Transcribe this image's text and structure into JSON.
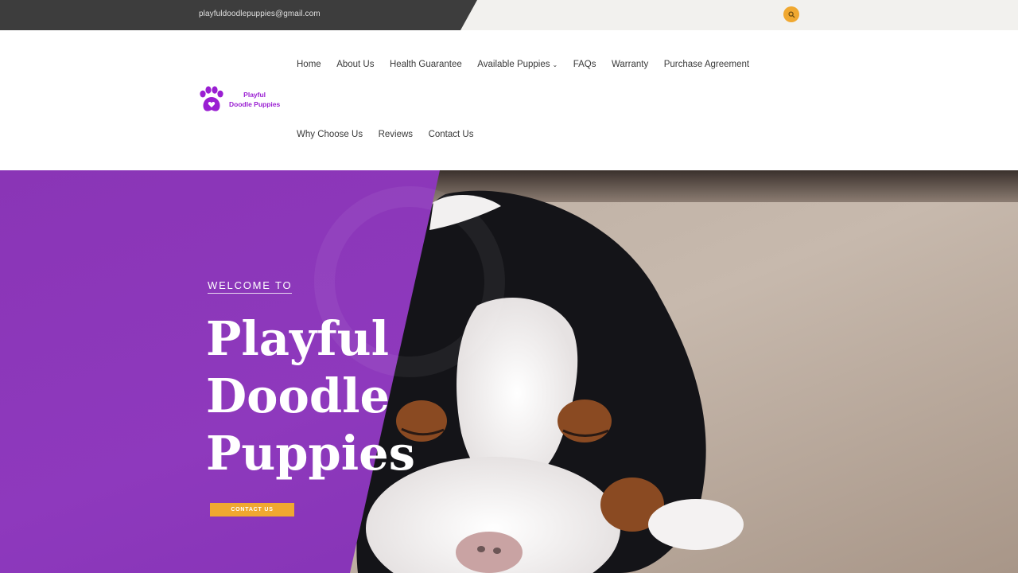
{
  "topbar": {
    "email": "playfuldoodlepuppies@gmail.com",
    "search_icon": "search-icon",
    "accent": "#f0a830"
  },
  "logo": {
    "line1": "Playful",
    "line2": "Doodle Puppies",
    "icon": "paw-heart-icon",
    "color": "#9a1ed2"
  },
  "nav": {
    "row1": [
      {
        "label": "Home"
      },
      {
        "label": "About Us"
      },
      {
        "label": "Health Guarantee"
      },
      {
        "label": "Available Puppies",
        "has_dropdown": true
      },
      {
        "label": "FAQs"
      },
      {
        "label": "Warranty"
      },
      {
        "label": "Purchase Agreement"
      }
    ],
    "row2": [
      {
        "label": "Why Choose Us"
      },
      {
        "label": "Reviews"
      },
      {
        "label": "Contact Us"
      }
    ]
  },
  "hero": {
    "welcome": "WELCOME TO",
    "title_lines": [
      "Playful",
      "Doodle",
      "Puppies"
    ],
    "button_label": "CONTACT US",
    "panel_color": "#8a35b6",
    "button_color": "#f0a830"
  }
}
